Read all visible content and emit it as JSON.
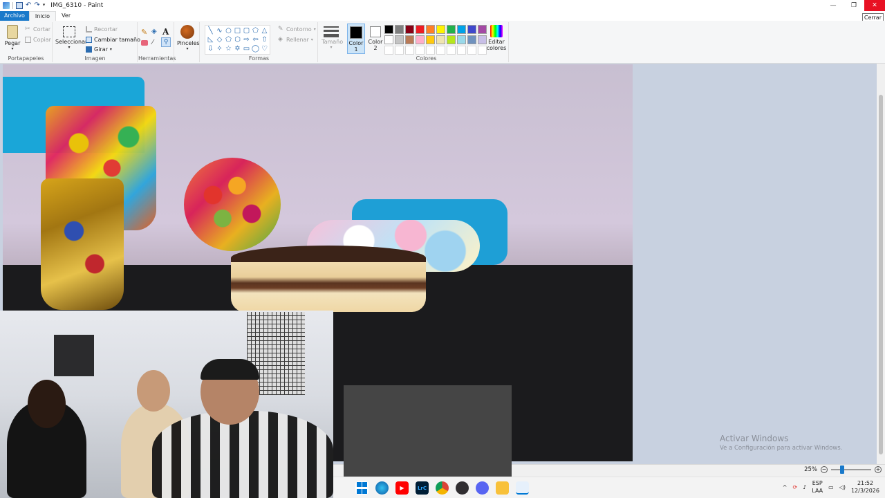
{
  "window": {
    "title": "IMG_6310 - Paint",
    "minimize": "—",
    "restore": "❐",
    "close": "✕",
    "close_tooltip": "Cerrar"
  },
  "tabs": {
    "file": "Archivo",
    "home": "Inicio",
    "view": "Ver"
  },
  "ribbon": {
    "clipboard": {
      "label": "Portapapeles",
      "paste": "Pegar",
      "cut": "Cortar",
      "copy": "Copiar"
    },
    "image": {
      "label": "Imagen",
      "select": "Seleccionar",
      "crop": "Recortar",
      "resize": "Cambiar tamaño",
      "rotate": "Girar"
    },
    "tools": {
      "label": "Herramientas"
    },
    "brushes": {
      "label": "Pinceles"
    },
    "shapes": {
      "label": "Formas",
      "outline": "Contorno",
      "fill": "Rellenar"
    },
    "size": {
      "label": "Tamaño"
    },
    "color1": {
      "label": "Color",
      "num": "1"
    },
    "color2": {
      "label": "Color",
      "num": "2"
    },
    "colors": {
      "label": "Colores",
      "edit": "Editar",
      "edit2": "colores",
      "palette": [
        "#000000",
        "#7f7f7f",
        "#880015",
        "#ed1c24",
        "#ff7f27",
        "#fff200",
        "#22b14c",
        "#00a2e8",
        "#3f48cc",
        "#a349a4",
        "#ffffff",
        "#c3c3c3",
        "#b97a57",
        "#ffaec9",
        "#ffc90e",
        "#efe4b0",
        "#b5e61d",
        "#99d9ea",
        "#7092be",
        "#c8bfe7",
        "#ffffff",
        "#ffffff",
        "#ffffff",
        "#ffffff",
        "#ffffff",
        "#ffffff",
        "#ffffff",
        "#ffffff",
        "#ffffff",
        "#ffffff"
      ]
    }
  },
  "watermark": {
    "line1": "Activar Windows",
    "line2": "Ve a Configuración para activar Windows."
  },
  "status": {
    "zoom": "25%"
  },
  "taskbar": {
    "lang1": "ESP",
    "lang2": "LAA",
    "time": "21:52",
    "date": "12/3/2026",
    "lrc": "LrC"
  }
}
